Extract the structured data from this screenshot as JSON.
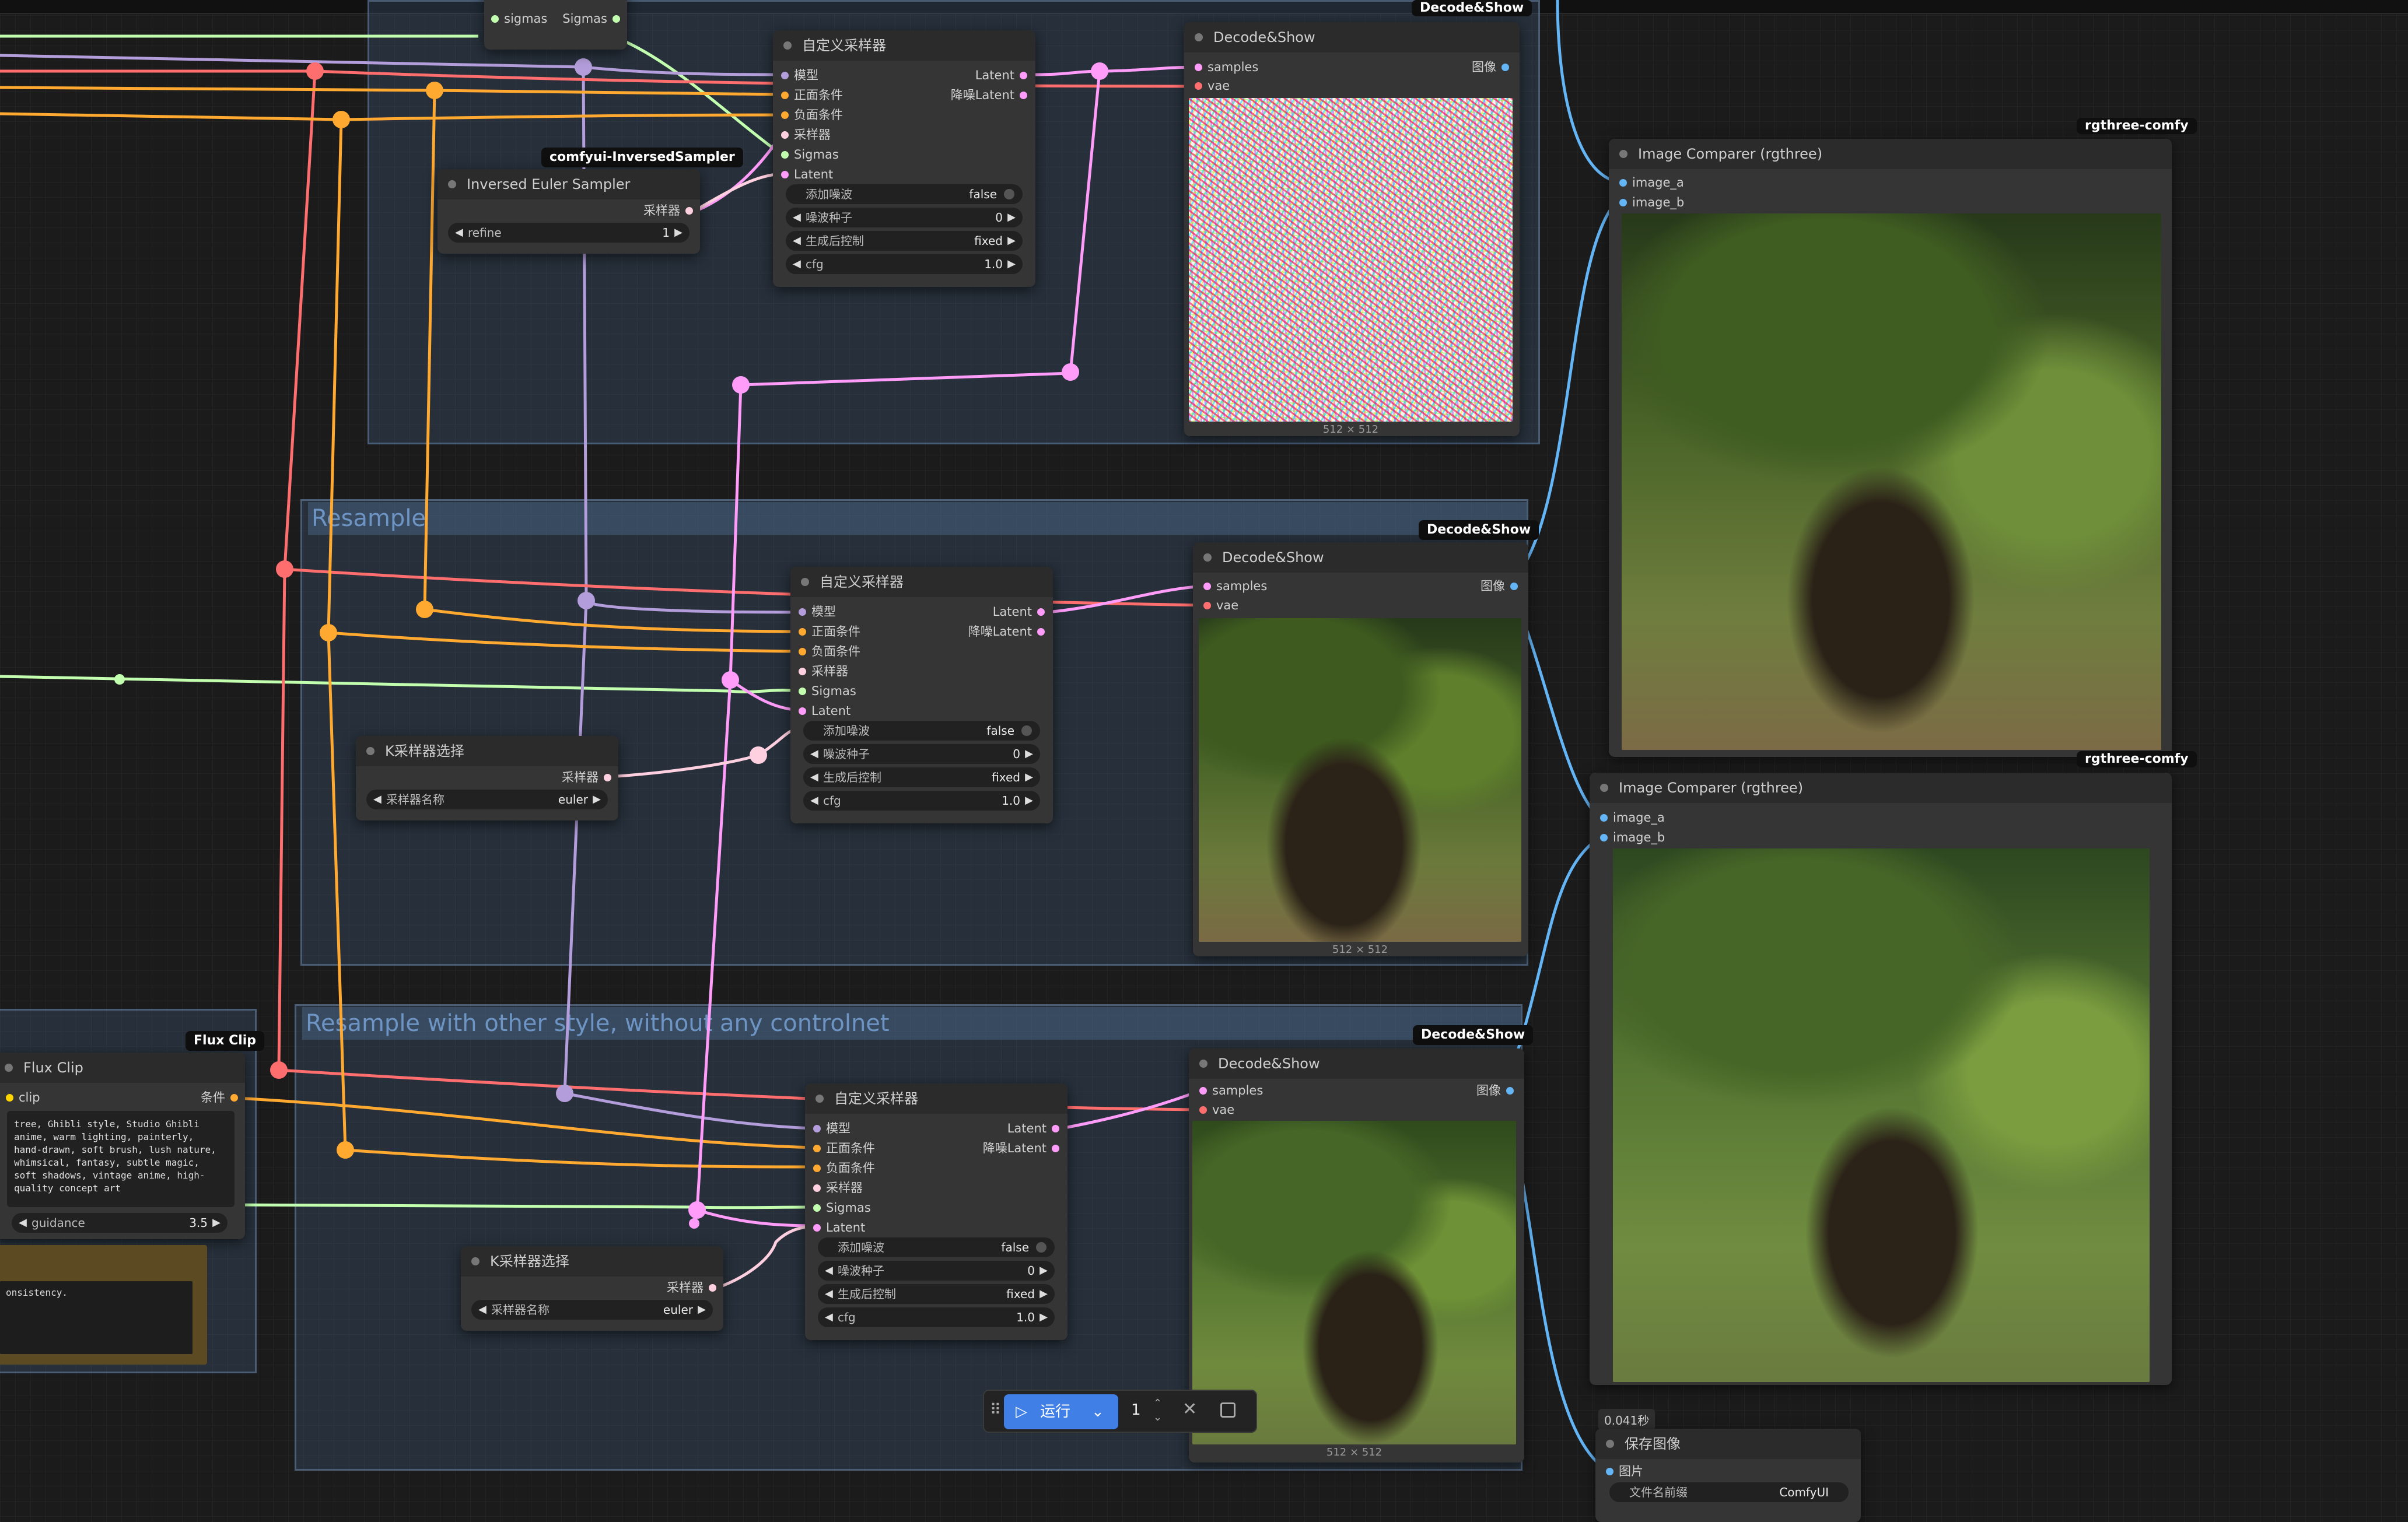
{
  "groups": [
    {
      "title": ""
    },
    {
      "title": "Resample"
    },
    {
      "title": "Resample with other style, without any controlnet"
    }
  ],
  "badges": {
    "inversed_sampler": "comfyui-InversedSampler",
    "decode_show": "Decode&Show",
    "rgthree": "rgthree-comfy",
    "flux_clip": "Flux Clip"
  },
  "custom_sampler": {
    "title": "自定义采样器",
    "inputs": [
      "模型",
      "正面条件",
      "负面条件",
      "采样器",
      "Sigmas",
      "Latent"
    ],
    "outputs": [
      "Latent",
      "降噪Latent"
    ],
    "widgets": {
      "add_noise_label": "添加噪波",
      "add_noise_value": "false",
      "seed_label": "噪波种子",
      "seed_value": "0",
      "control_label": "生成后控制",
      "control_value": "fixed",
      "cfg_label": "cfg",
      "cfg_value": "1.0"
    }
  },
  "inversed_euler": {
    "title": "Inversed Euler Sampler",
    "output": "采样器",
    "widget_label": "refine",
    "widget_value": "1"
  },
  "ksampler_select": {
    "title": "K采样器选择",
    "output": "采样器",
    "widget_label": "采样器名称",
    "widget_value": "euler"
  },
  "sigmas_node": {
    "input": "sigmas",
    "output": "Sigmas"
  },
  "decode_show": {
    "title": "Decode&Show",
    "inputs": [
      "samples",
      "vae"
    ],
    "output": "图像",
    "size_label": "512 × 512"
  },
  "image_comparer": {
    "title": "Image Comparer (rgthree)",
    "inputs": [
      "image_a",
      "image_b"
    ]
  },
  "flux_clip": {
    "title": "Flux Clip",
    "input": "clip",
    "output": "条件",
    "prompt": "tree, Ghibli style, Studio Ghibli anime, warm lighting, painterly, hand-drawn, soft brush, lush nature, whimsical, fantasy, subtle magic, soft shadows, vintage anime, high-quality concept art",
    "widget_label": "guidance",
    "widget_value": "3.5"
  },
  "note_text": "onsistency.",
  "save_image": {
    "title": "保存图像",
    "input": "图片",
    "widget_label": "文件名前缀",
    "widget_value": "ComfyUI",
    "timer": "0.041秒"
  },
  "run_bar": {
    "run_label": "运行",
    "count": "1"
  },
  "colors": {
    "model": "#b39ddb",
    "positive": "#ffa931",
    "negative": "#ffa931",
    "sampler": "#ececec",
    "sigmas": "#c2ffae",
    "latent": "#ff9cf9",
    "vae": "#ff6e6e",
    "image": "#64b5f6",
    "clip": "#ffd500",
    "run": "#3f7fe6"
  }
}
